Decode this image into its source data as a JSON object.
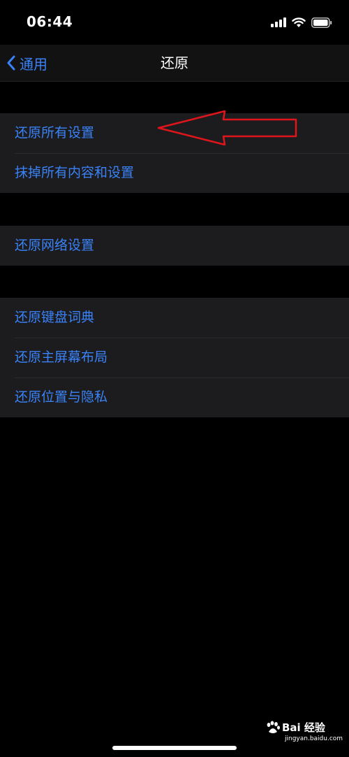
{
  "status_bar": {
    "time": "06:44",
    "icons": [
      "signal-icon",
      "wifi-icon",
      "battery-icon"
    ]
  },
  "nav": {
    "back_label": "通用",
    "title": "还原"
  },
  "groups": [
    {
      "items": [
        {
          "label": "还原所有设置"
        },
        {
          "label": "抹掉所有内容和设置"
        }
      ]
    },
    {
      "items": [
        {
          "label": "还原网络设置"
        }
      ]
    },
    {
      "items": [
        {
          "label": "还原键盘词典"
        },
        {
          "label": "还原主屏幕布局"
        },
        {
          "label": "还原位置与隐私"
        }
      ]
    }
  ],
  "annotation": {
    "color": "#e0151b",
    "points_to": "还原所有设置"
  },
  "watermark": {
    "brand": "Bai 经验",
    "url": "jingyan.baidu.com"
  },
  "colors": {
    "accent": "#3a82f7",
    "background": "#000000",
    "cell": "#1c1c1e"
  }
}
